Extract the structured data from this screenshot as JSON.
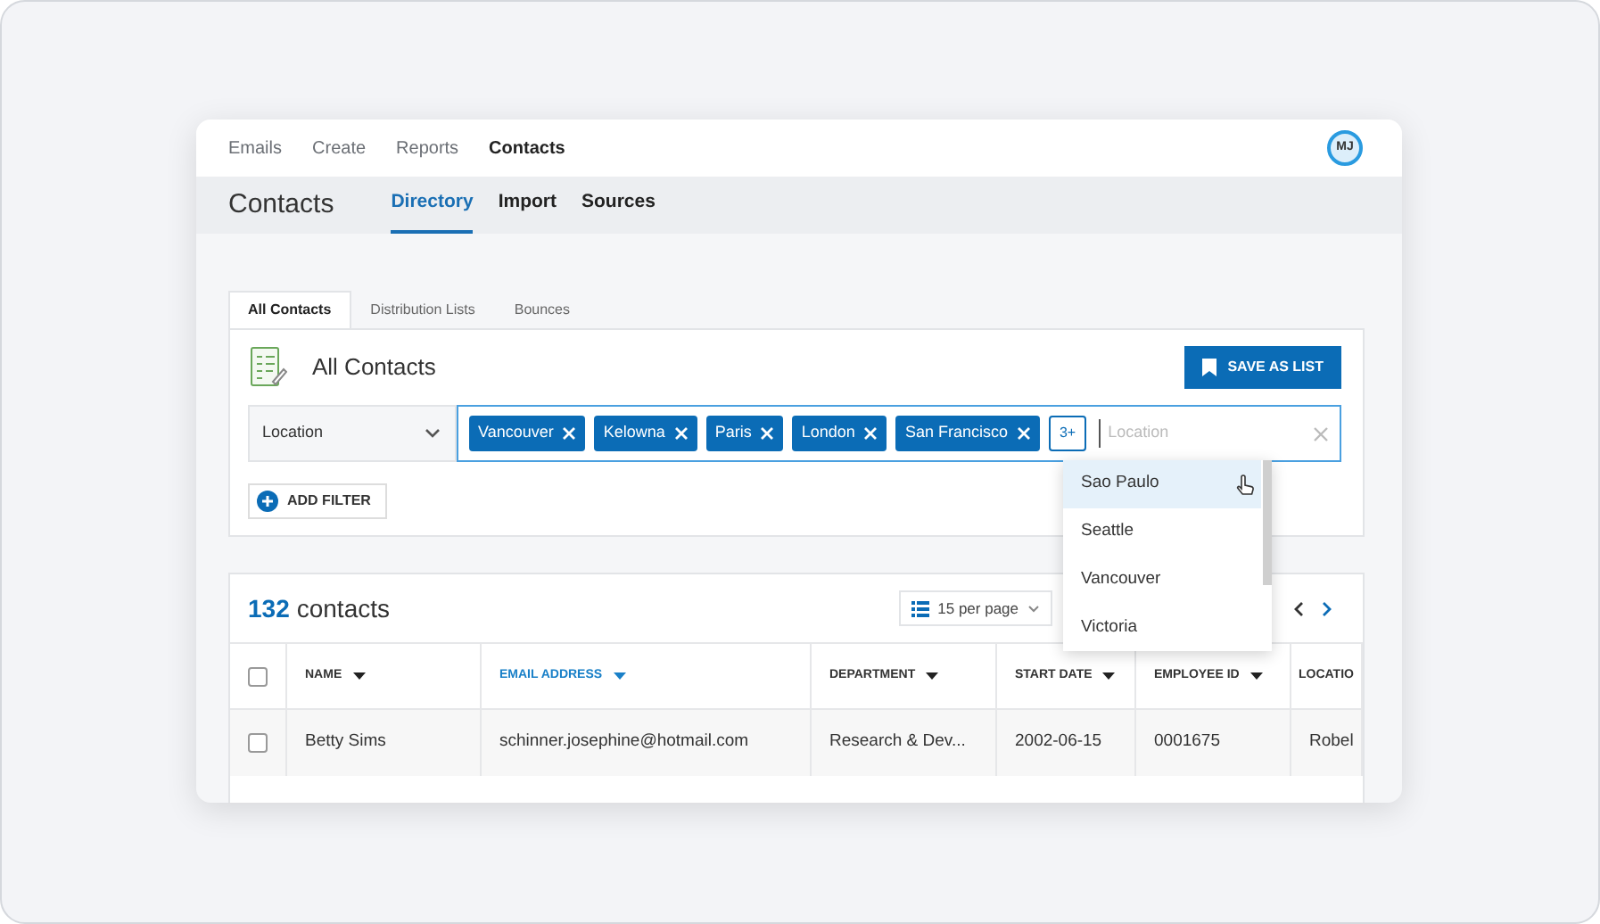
{
  "top_nav": {
    "items": [
      {
        "label": "Emails",
        "selected": false
      },
      {
        "label": "Create",
        "selected": false
      },
      {
        "label": "Reports",
        "selected": false
      },
      {
        "label": "Contacts",
        "selected": true
      }
    ],
    "avatar": "MJ"
  },
  "page_header": {
    "title": "Contacts",
    "tabs": [
      {
        "label": "Directory",
        "selected": true
      },
      {
        "label": "Import",
        "selected": false
      },
      {
        "label": "Sources",
        "selected": false
      }
    ]
  },
  "sub_tabs": [
    {
      "label": "All Contacts",
      "selected": true
    },
    {
      "label": "Distribution Lists",
      "selected": false
    },
    {
      "label": "Bounces",
      "selected": false
    }
  ],
  "filter_card": {
    "title": "All Contacts",
    "save_button": "SAVE AS LIST",
    "filter_field": "Location",
    "tags": [
      "Vancouver",
      "Kelowna",
      "Paris",
      "London",
      "San Francisco"
    ],
    "more_count": "3+",
    "placeholder": "Location",
    "add_filter": "ADD FILTER"
  },
  "dropdown": {
    "options": [
      {
        "label": "Sao Paulo",
        "highlighted": true
      },
      {
        "label": "Seattle",
        "highlighted": false
      },
      {
        "label": "Vancouver",
        "highlighted": false
      },
      {
        "label": "Victoria",
        "highlighted": false
      }
    ]
  },
  "contacts": {
    "count": "132",
    "select_all_checked": false,
    "count_label": "contacts",
    "per_page": "15 per page",
    "columns": [
      {
        "label": "NAME",
        "sorted": false,
        "sort_arrow": true
      },
      {
        "label": "EMAIL ADDRESS",
        "sorted": true,
        "sort_arrow": true
      },
      {
        "label": "DEPARTMENT",
        "sorted": false,
        "sort_arrow": true
      },
      {
        "label": "START DATE",
        "sorted": false,
        "sort_arrow": true
      },
      {
        "label": "EMPLOYEE ID",
        "sorted": false,
        "sort_arrow": true
      },
      {
        "label": "LOCATIO",
        "sorted": false,
        "sort_arrow": false
      }
    ],
    "rows": [
      {
        "checked": false,
        "cells": [
          "Betty Sims",
          "schinner.josephine@hotmail.com",
          "Research & Dev...",
          "2002-06-15",
          "0001675",
          "Robel"
        ]
      }
    ]
  }
}
